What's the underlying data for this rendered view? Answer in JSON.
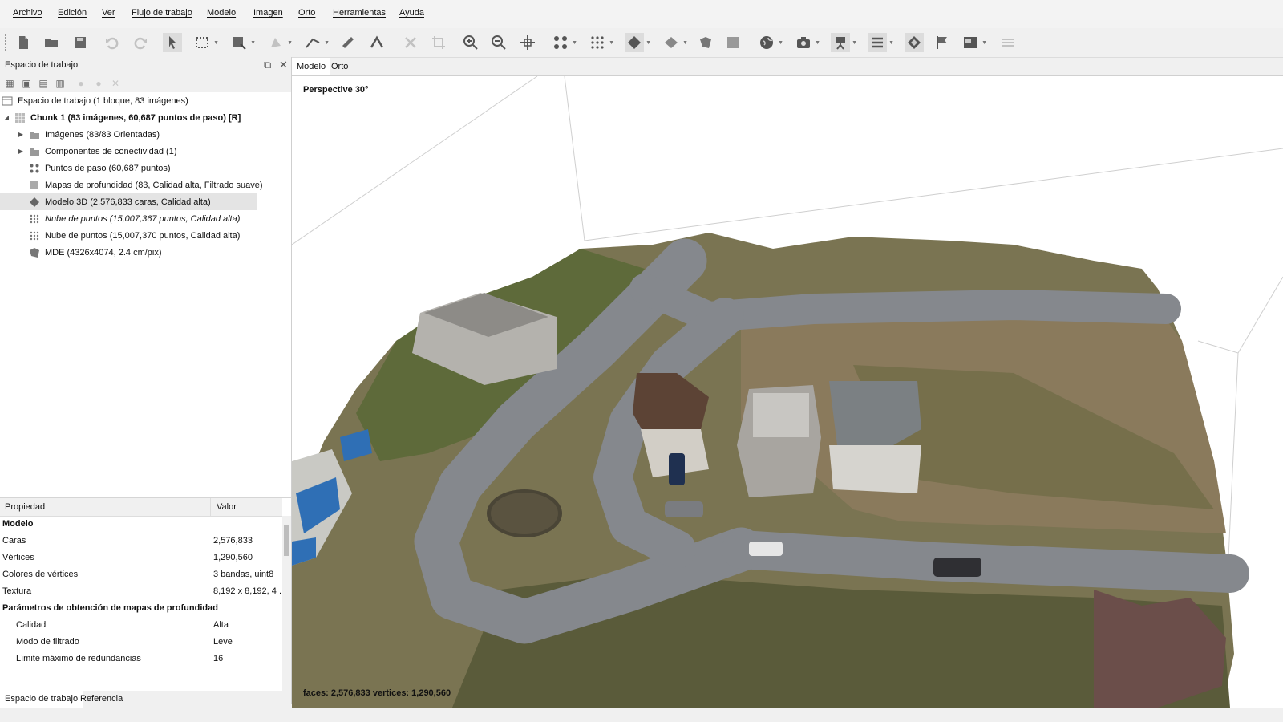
{
  "menu": [
    "Archivo",
    "Edición",
    "Ver",
    "Flujo de trabajo",
    "Modelo",
    "Imagen",
    "Orto",
    "Herramientas",
    "Ayuda"
  ],
  "toolbar_icons": [
    "new-file-icon",
    "open-folder-icon",
    "save-icon",
    "undo-icon",
    "redo-icon",
    "navigation-arrow-icon",
    "rectangle-selection-icon",
    "resize-region-icon",
    "draw-shape-icon",
    "polyline-icon",
    "ruler-icon",
    "measure-angle-icon",
    "delete-icon",
    "crop-icon",
    "zoom-in-icon",
    "zoom-out-icon",
    "move-object-icon",
    "tie-points-icon",
    "dense-cloud-icon",
    "model-icon",
    "tiled-model-icon",
    "dem-icon",
    "ortho-icon",
    "globe-icon",
    "camera-icon",
    "camera-tripod-icon",
    "layers-icon",
    "shape-icon",
    "flag-icon",
    "image-icon",
    "grid-icon"
  ],
  "workspace": {
    "title": "Espacio de trabajo",
    "tree": [
      {
        "label": "Espacio de trabajo (1 bloque, 83 imágenes)",
        "icon": "workspace-icon",
        "style": "normal"
      },
      {
        "label": "Chunk 1 (83 imágenes, 60,687 puntos de paso) [R]",
        "icon": "chunk-icon",
        "style": "bold"
      },
      {
        "label": "Imágenes (83/83 Orientadas)",
        "icon": "folder-icon",
        "style": "normal"
      },
      {
        "label": "Componentes de conectividad (1)",
        "icon": "folder-icon",
        "style": "normal"
      },
      {
        "label": "Puntos de paso (60,687 puntos)",
        "icon": "tie-points-icon",
        "style": "normal"
      },
      {
        "label": "Mapas de profundidad (83, Calidad alta, Filtrado suave)",
        "icon": "depth-maps-icon",
        "style": "normal"
      },
      {
        "label": "Modelo 3D (2,576,833 caras, Calidad alta)",
        "icon": "model-3d-icon",
        "style": "normal"
      },
      {
        "label": "Nube de puntos (15,007,367 puntos, Calidad alta)",
        "icon": "point-cloud-icon",
        "style": "italic"
      },
      {
        "label": "Nube de puntos (15,007,370 puntos, Calidad alta)",
        "icon": "point-cloud-icon",
        "style": "normal"
      },
      {
        "label": "MDE (4326x4074, 2.4 cm/pix)",
        "icon": "dem-icon",
        "style": "normal"
      }
    ]
  },
  "properties": {
    "col_property": "Propiedad",
    "col_value": "Valor",
    "rows": [
      {
        "key": "Modelo",
        "value": "",
        "type": "section"
      },
      {
        "key": "Caras",
        "value": "2,576,833",
        "type": "row"
      },
      {
        "key": "Vértices",
        "value": "1,290,560",
        "type": "row"
      },
      {
        "key": "Colores de vértices",
        "value": "3 bandas, uint8",
        "type": "row"
      },
      {
        "key": "Textura",
        "value": "8,192 x 8,192, 4 ...",
        "type": "row"
      },
      {
        "key": "Parámetros de obtención de mapas de profundidad",
        "value": "",
        "type": "section"
      },
      {
        "key": "Calidad",
        "value": "Alta",
        "type": "sub"
      },
      {
        "key": "Modo de filtrado",
        "value": "Leve",
        "type": "sub"
      },
      {
        "key": "Límite máximo de redundancias",
        "value": "16",
        "type": "sub"
      }
    ]
  },
  "bottom_tabs": [
    "Espacio de trabajo",
    "Referencia"
  ],
  "view_tabs": [
    "Modelo",
    "Orto"
  ],
  "viewport": {
    "perspective_label": "Perspective 30°",
    "stats": "faces: 2,576,833 vertices: 1,290,560"
  },
  "colors": {
    "selection": "#e4e4e4",
    "road": "#7d8085",
    "grass": "#6a6a3a",
    "soil": "#8a7a5c"
  }
}
